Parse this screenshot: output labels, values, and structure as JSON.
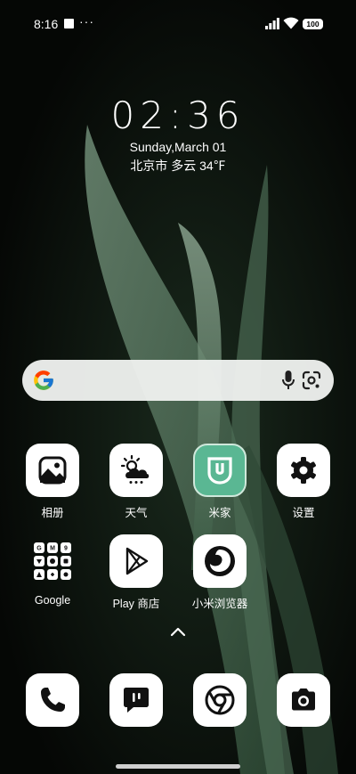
{
  "status_bar": {
    "time": "8:16",
    "dots": "···",
    "battery": "100",
    "icons": [
      "signal-icon",
      "wifi-icon",
      "battery-icon"
    ]
  },
  "clock": {
    "time": "02:36",
    "date": "Sunday,March 01",
    "weather": "北京市 多云 34℉"
  },
  "search_bar": {
    "icons": [
      "google-logo-icon",
      "mic-icon",
      "lens-icon"
    ]
  },
  "apps": [
    {
      "label": "相册",
      "icon": "gallery-icon"
    },
    {
      "label": "天气",
      "icon": "weather-icon"
    },
    {
      "label": "米家",
      "icon": "mijia-icon"
    },
    {
      "label": "设置",
      "icon": "gear-icon"
    },
    {
      "label": "Google",
      "icon": "google-folder-icon"
    },
    {
      "label": "Play 商店",
      "icon": "play-store-icon"
    },
    {
      "label": "小米浏览器",
      "icon": "browser-icon"
    }
  ],
  "dock": [
    {
      "icon": "phone-icon"
    },
    {
      "icon": "messages-icon"
    },
    {
      "icon": "chrome-icon"
    },
    {
      "icon": "camera-icon"
    }
  ],
  "colors": {
    "background": "#060806",
    "mijia": "#5ab793",
    "tile": "#ffffff"
  }
}
